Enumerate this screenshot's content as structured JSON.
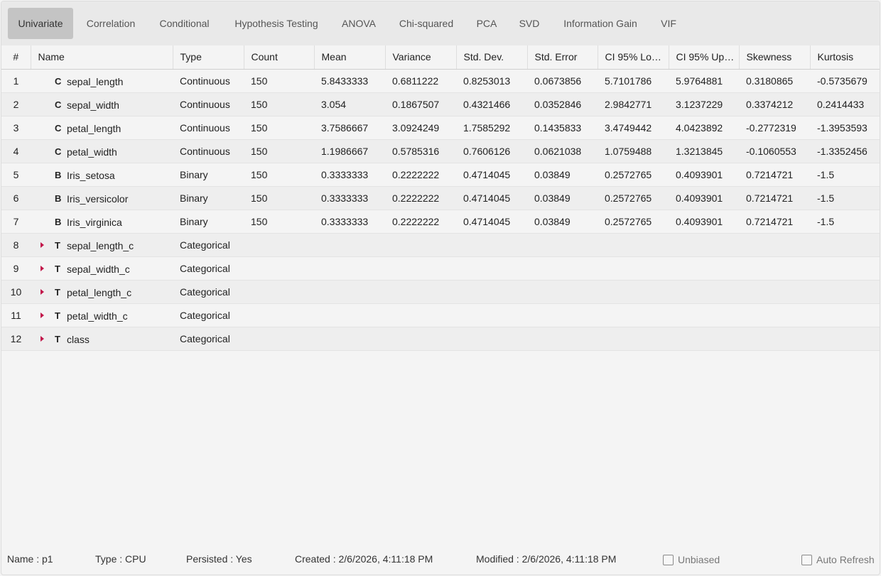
{
  "tabs": [
    {
      "label": "Univariate",
      "active": true
    },
    {
      "label": "Correlation"
    },
    {
      "label": "Conditional"
    },
    {
      "label": "Hypothesis Testing"
    },
    {
      "label": "ANOVA"
    },
    {
      "label": "Chi-squared"
    },
    {
      "label": "PCA"
    },
    {
      "label": "SVD"
    },
    {
      "label": "Information Gain"
    },
    {
      "label": "VIF"
    }
  ],
  "columns": [
    "#",
    "Name",
    "Type",
    "Count",
    "Mean",
    "Variance",
    "Std. Dev.",
    "Std. Error",
    "CI 95% Lo…",
    "CI 95% Up…",
    "Skewness",
    "Kurtosis"
  ],
  "rows": [
    {
      "idx": "1",
      "code": "C",
      "expandable": false,
      "name": "sepal_length",
      "type": "Continuous",
      "count": "150",
      "mean": "5.8433333",
      "variance": "0.6811222",
      "std": "0.8253013",
      "stderr": "0.0673856",
      "cilo": "5.7101786",
      "ciup": "5.9764881",
      "skew": "0.3180865",
      "kurt": "-0.5735679"
    },
    {
      "idx": "2",
      "code": "C",
      "expandable": false,
      "name": "sepal_width",
      "type": "Continuous",
      "count": "150",
      "mean": "3.054",
      "variance": "0.1867507",
      "std": "0.4321466",
      "stderr": "0.0352846",
      "cilo": "2.9842771",
      "ciup": "3.1237229",
      "skew": "0.3374212",
      "kurt": "0.2414433"
    },
    {
      "idx": "3",
      "code": "C",
      "expandable": false,
      "name": "petal_length",
      "type": "Continuous",
      "count": "150",
      "mean": "3.7586667",
      "variance": "3.0924249",
      "std": "1.7585292",
      "stderr": "0.1435833",
      "cilo": "3.4749442",
      "ciup": "4.0423892",
      "skew": "-0.2772319",
      "kurt": "-1.3953593"
    },
    {
      "idx": "4",
      "code": "C",
      "expandable": false,
      "name": "petal_width",
      "type": "Continuous",
      "count": "150",
      "mean": "1.1986667",
      "variance": "0.5785316",
      "std": "0.7606126",
      "stderr": "0.0621038",
      "cilo": "1.0759488",
      "ciup": "1.3213845",
      "skew": "-0.1060553",
      "kurt": "-1.3352456"
    },
    {
      "idx": "5",
      "code": "B",
      "expandable": false,
      "name": "Iris_setosa",
      "type": "Binary",
      "count": "150",
      "mean": "0.3333333",
      "variance": "0.2222222",
      "std": "0.4714045",
      "stderr": "0.03849",
      "cilo": "0.2572765",
      "ciup": "0.4093901",
      "skew": "0.7214721",
      "kurt": "-1.5"
    },
    {
      "idx": "6",
      "code": "B",
      "expandable": false,
      "name": "Iris_versicolor",
      "type": "Binary",
      "count": "150",
      "mean": "0.3333333",
      "variance": "0.2222222",
      "std": "0.4714045",
      "stderr": "0.03849",
      "cilo": "0.2572765",
      "ciup": "0.4093901",
      "skew": "0.7214721",
      "kurt": "-1.5"
    },
    {
      "idx": "7",
      "code": "B",
      "expandable": false,
      "name": "Iris_virginica",
      "type": "Binary",
      "count": "150",
      "mean": "0.3333333",
      "variance": "0.2222222",
      "std": "0.4714045",
      "stderr": "0.03849",
      "cilo": "0.2572765",
      "ciup": "0.4093901",
      "skew": "0.7214721",
      "kurt": "-1.5"
    },
    {
      "idx": "8",
      "code": "T",
      "expandable": true,
      "name": "sepal_length_c",
      "type": "Categorical",
      "count": "",
      "mean": "",
      "variance": "",
      "std": "",
      "stderr": "",
      "cilo": "",
      "ciup": "",
      "skew": "",
      "kurt": ""
    },
    {
      "idx": "9",
      "code": "T",
      "expandable": true,
      "name": "sepal_width_c",
      "type": "Categorical",
      "count": "",
      "mean": "",
      "variance": "",
      "std": "",
      "stderr": "",
      "cilo": "",
      "ciup": "",
      "skew": "",
      "kurt": ""
    },
    {
      "idx": "10",
      "code": "T",
      "expandable": true,
      "name": "petal_length_c",
      "type": "Categorical",
      "count": "",
      "mean": "",
      "variance": "",
      "std": "",
      "stderr": "",
      "cilo": "",
      "ciup": "",
      "skew": "",
      "kurt": ""
    },
    {
      "idx": "11",
      "code": "T",
      "expandable": true,
      "name": "petal_width_c",
      "type": "Categorical",
      "count": "",
      "mean": "",
      "variance": "",
      "std": "",
      "stderr": "",
      "cilo": "",
      "ciup": "",
      "skew": "",
      "kurt": ""
    },
    {
      "idx": "12",
      "code": "T",
      "expandable": true,
      "name": "class",
      "type": "Categorical",
      "count": "",
      "mean": "",
      "variance": "",
      "std": "",
      "stderr": "",
      "cilo": "",
      "ciup": "",
      "skew": "",
      "kurt": ""
    }
  ],
  "status": {
    "name": "Name : p1",
    "type": "Type : CPU",
    "persisted": "Persisted : Yes",
    "created": "Created : 2/6/2026, 4:11:18 PM",
    "modified": "Modified : 2/6/2026, 4:11:18 PM",
    "unbiased_label": "Unbiased",
    "unbiased_checked": false,
    "autorefresh_label": "Auto Refresh",
    "autorefresh_checked": false
  },
  "colors": {
    "accent_arrow": "#c2184b",
    "active_tab": "#c4c4c4"
  },
  "icons": {
    "expand": "caret-right-icon"
  }
}
